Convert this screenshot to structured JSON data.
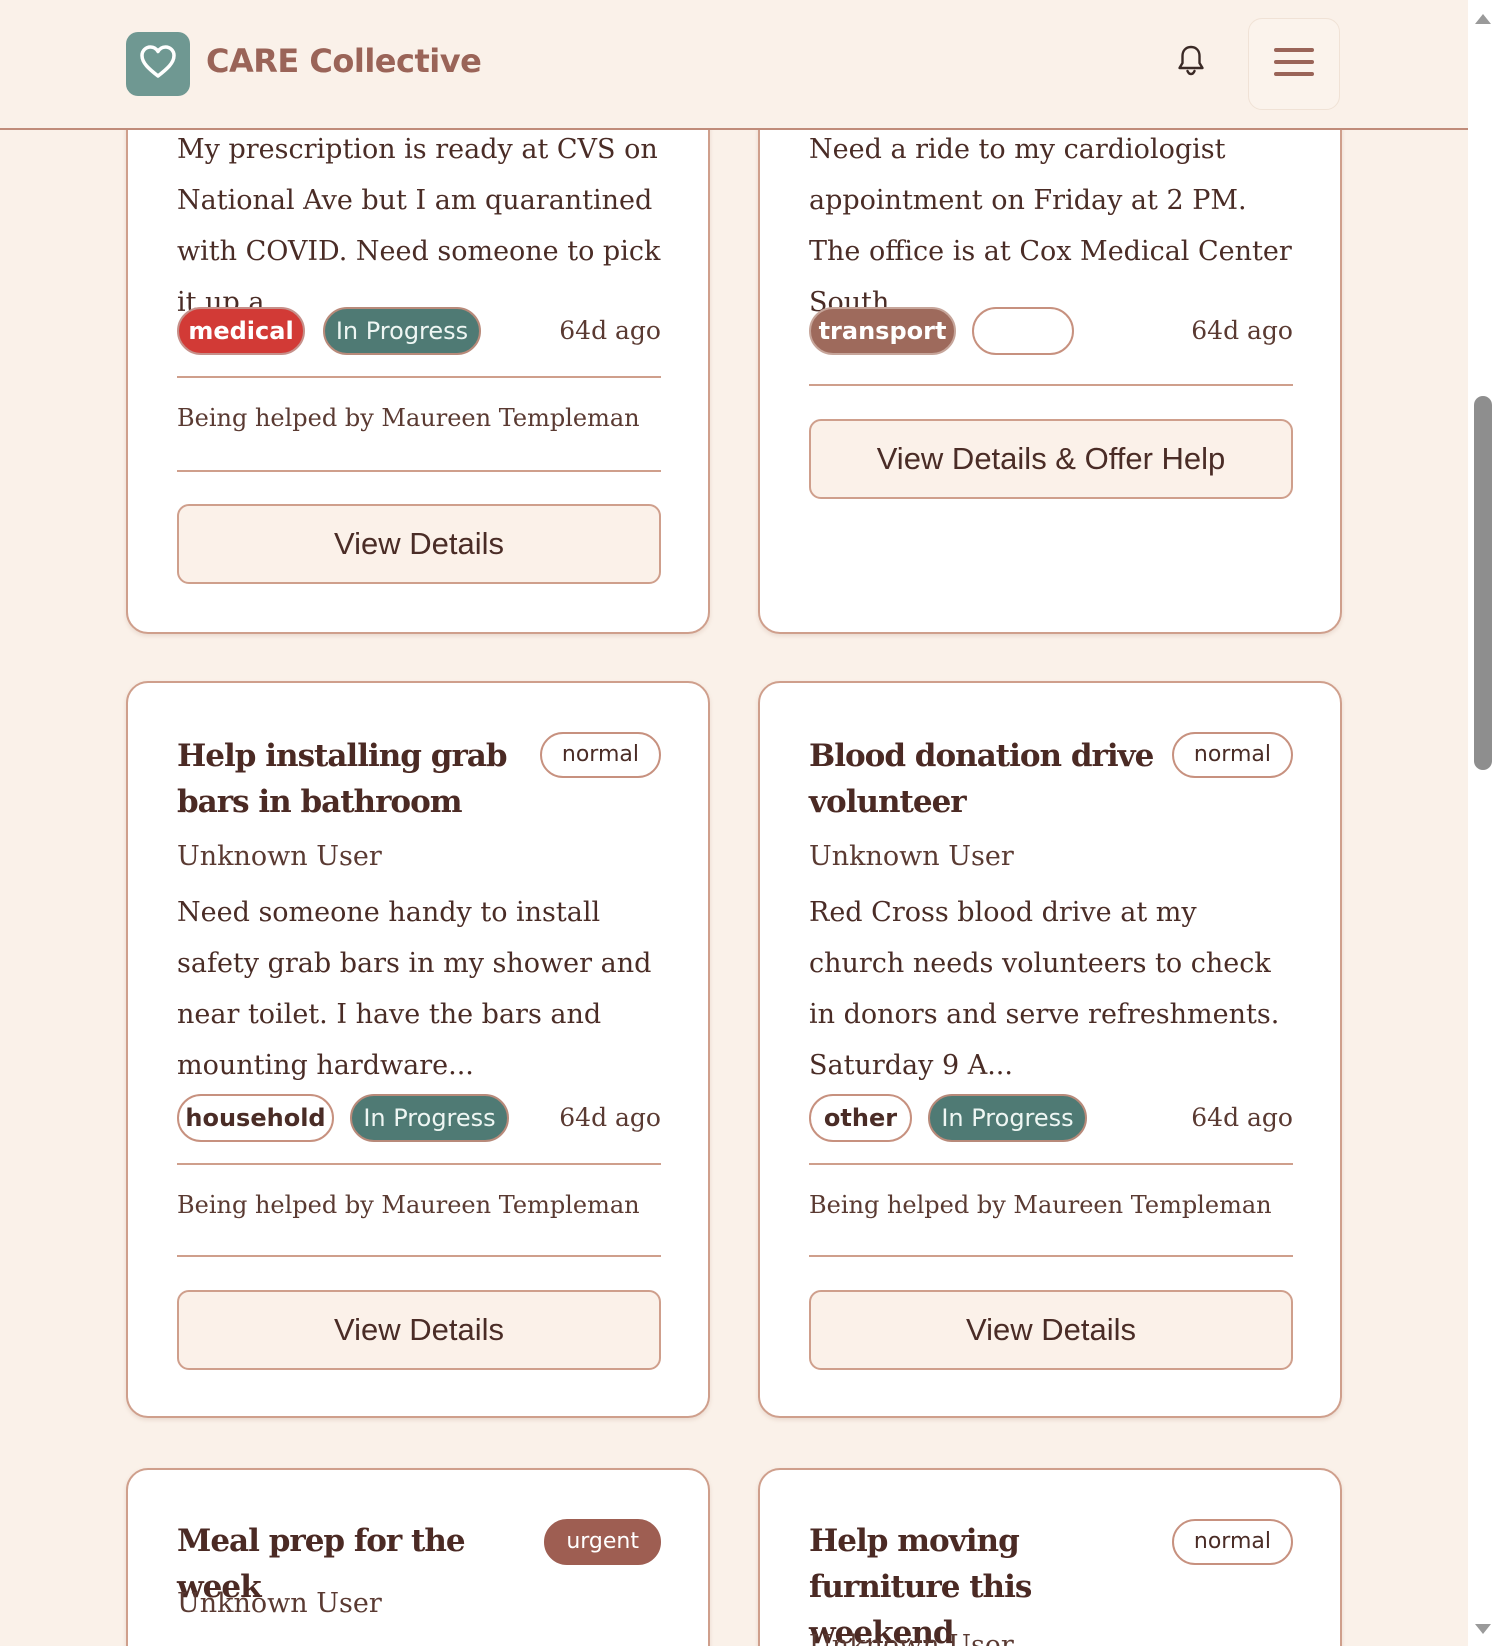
{
  "app": {
    "brand": "CARE Collective"
  },
  "cards": [
    {
      "description": "My prescription is ready at CVS on National Ave but I am quarantined with COVID. Need someone to pick it up a...",
      "category": "medical",
      "status": "In Progress",
      "age": "64d ago",
      "helper": "Being helped by Maureen Templeman",
      "button": "View Details"
    },
    {
      "description": "Need a ride to my cardiologist appointment on Friday at 2 PM. The office is at Cox Medical Center South....",
      "category": "transport",
      "status": "",
      "age": "64d ago",
      "button": "View Details & Offer Help"
    },
    {
      "title": "Help installing grab bars in bathroom",
      "priority": "normal",
      "author": "Unknown User",
      "description": "Need someone handy to install safety grab bars in my shower and near toilet. I have the bars and mounting hardware...",
      "category": "household",
      "status": "In Progress",
      "age": "64d ago",
      "helper": "Being helped by Maureen Templeman",
      "button": "View Details"
    },
    {
      "title": "Blood donation drive volunteer",
      "priority": "normal",
      "author": "Unknown User",
      "description": "Red Cross blood drive at my church needs volunteers to check in donors and serve refreshments. Saturday 9 A...",
      "category": "other",
      "status": "In Progress",
      "age": "64d ago",
      "helper": "Being helped by Maureen Templeman",
      "button": "View Details"
    },
    {
      "title": "Meal prep for the week",
      "priority": "urgent",
      "author": "Unknown User"
    },
    {
      "title": "Help moving furniture this weekend",
      "priority": "normal",
      "author": "Unknown User"
    }
  ],
  "icons": {
    "logo": "heart-icon",
    "notifications": "bell-icon",
    "menu": "hamburger-menu-icon"
  },
  "colors": {
    "accent": "#6f9892",
    "brand_text": "#9a6458",
    "medical": "#d23a36",
    "status": "#4f7a74",
    "urgent": "#9e5e52"
  }
}
